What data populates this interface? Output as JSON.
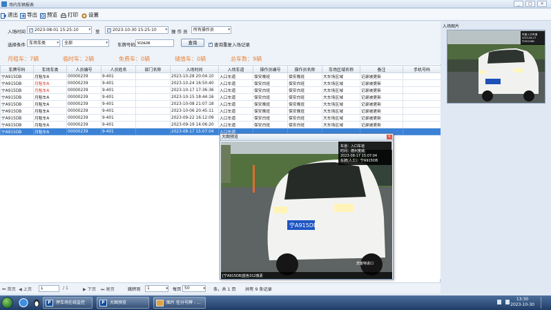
{
  "window": {
    "title": "场内车辆报表",
    "minimize": "_",
    "restore": "□",
    "close": "×"
  },
  "toolbar": {
    "exit": "退出",
    "export": "导出",
    "preview": "预览",
    "print": "打印",
    "settings": "设置"
  },
  "filters": {
    "entry_time_label": "入场时间",
    "from": "2023-08-01 15:25:10",
    "to_label": "至",
    "to": "2023-10-30 15:25:10",
    "operator_label": "操 作 员",
    "operator_value": "所有操作员",
    "condition_label": "选择条件",
    "condition_value": "车场车类",
    "condition_sub": "全部",
    "plate_label": "车牌号码",
    "plate_value": "915DB",
    "query_button": "查询",
    "repeat_check_label": "查询重复入场记录"
  },
  "stats": {
    "monthly": "月租车：7辆",
    "temporary": "临时车：2辆",
    "free": "免费车：0辆",
    "stored": "储值车：0辆",
    "total": "总车数：9辆"
  },
  "table": {
    "columns": [
      "车牌号码",
      "车场车类",
      "人员编号",
      "人员姓名",
      "部门名称",
      "入场时间",
      "入场车道",
      "操作员编号",
      "操作员名称",
      "车场区域名称",
      "备注",
      "手机号码"
    ],
    "rows": [
      [
        "宁A915DB",
        "月租车A",
        "00000239",
        "9-401",
        "",
        "2023-10-28 20:04:10",
        "入口车道",
        "保安晚班",
        "保安晚班",
        "大车场区域",
        "记录被更新",
        ""
      ],
      [
        "宁A915DB",
        "月租车A",
        "00000239",
        "9-401",
        "",
        "2023-10-24 16:50:40",
        "入口车道",
        "保安白班",
        "保安白班",
        "大车场区域",
        "记录被更新",
        ""
      ],
      [
        "宁A915DB",
        "月租车A",
        "00000239",
        "9-401",
        "",
        "2023-10-17 17:36:36",
        "入口车道",
        "保安白班",
        "保安白班",
        "大车场区域",
        "记录被更新",
        ""
      ],
      [
        "宁A915DB",
        "月租车A",
        "00000239",
        "9-401",
        "",
        "2023-10-15 18:44:16",
        "入口车道",
        "保安白班",
        "保安白班",
        "大车场区域",
        "记录被更新",
        ""
      ],
      [
        "宁A915DB",
        "月租车A",
        "00000239",
        "9-401",
        "",
        "2023-10-08 21:07:18",
        "入口车道",
        "保安晚班",
        "保安晚班",
        "大车场区域",
        "记录被更新",
        ""
      ],
      [
        "宁A915DB",
        "月租车A",
        "00000239",
        "9-401",
        "",
        "2023-10-06 20:45:11",
        "入口车道",
        "保安晚班",
        "保安晚班",
        "大车场区域",
        "记录被更新",
        ""
      ],
      [
        "宁A915DB",
        "月租车A",
        "00000239",
        "9-401",
        "",
        "2023-09-22 16:12:09",
        "入口车道",
        "保安白班",
        "保安白班",
        "大车场区域",
        "记录被更新",
        ""
      ],
      [
        "宁A915DB",
        "月租车A",
        "00000239",
        "9-401",
        "",
        "2023-09-19 14:06:20",
        "入口车道",
        "保安白班",
        "保安白班",
        "大车场区域",
        "记录被更新",
        ""
      ],
      [
        "宁A915DB",
        "月租车A",
        "00000239",
        "9-401",
        "",
        "2023-08-17 15:07:04",
        "入口车道",
        "",
        "",
        "",
        "",
        ""
      ]
    ],
    "red_category_rows": [
      1,
      2
    ],
    "selected_row": 8
  },
  "pager": {
    "first": "首页",
    "prev": "上页",
    "page": "1",
    "of": "/ 1",
    "next": "下页",
    "last": "尾页",
    "jump_label": "跳转到",
    "jump_value": "1",
    "per_page_label": "每页",
    "per_page_value": "50",
    "total_pages": "条，共 1 页",
    "total_records": "共有 9 条记录"
  },
  "right_panel": {
    "title": "入场图片",
    "overlay": "车道：入口车道\n车牌：宁A915DB\n2023-08-17 15:07:04"
  },
  "popup": {
    "title": "大图预览",
    "close": "×",
    "overlay_lines": [
      "车道：入口车道",
      "时间：德州宽城",
      "2023-08-17 15:07:04",
      "车牌(人工)：宁A915DB"
    ],
    "plate": "宁A915DB",
    "caption": "[宁A915DB]蓝色312像素",
    "watermark": "宾客特进口"
  },
  "taskbar": {
    "tasks": [
      "停车场在线监控",
      "大图预览",
      "图片 任分号牌 - ..."
    ],
    "time": "13:30",
    "date": "2023-10-30"
  },
  "colors": {
    "accent": "#3b82d6",
    "stat": "#e8833a",
    "red": "#d2372c"
  }
}
